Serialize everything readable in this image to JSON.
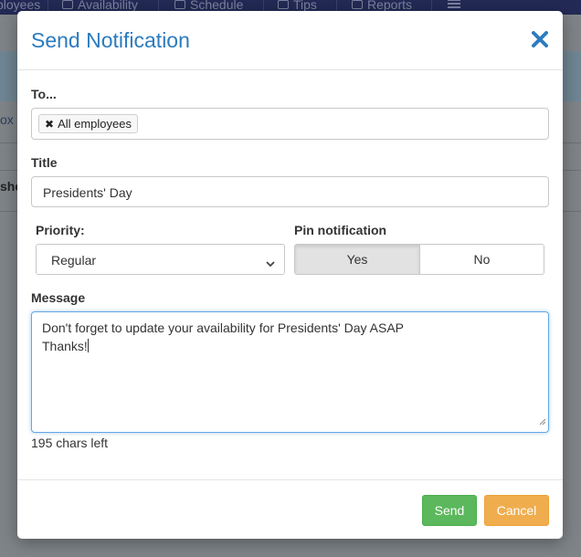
{
  "background_app": {
    "nav_items": [
      {
        "label": "ployees",
        "icon": ""
      },
      {
        "label": "Availability",
        "icon": "calendar-check-icon"
      },
      {
        "label": "Schedule",
        "icon": "grid-icon"
      },
      {
        "label": "Tips",
        "icon": "money-icon"
      },
      {
        "label": "Reports",
        "icon": "chart-icon"
      },
      {
        "label": "",
        "icon": "menu-icon"
      }
    ],
    "side_text_1": "ox",
    "side_text_2": "she"
  },
  "modal": {
    "title": "Send Notification",
    "close_icon": "close-icon",
    "to": {
      "label": "To...",
      "tags": [
        {
          "label": "All employees",
          "remove_icon": "close-icon"
        }
      ]
    },
    "title_field": {
      "label": "Title",
      "value": "Presidents' Day"
    },
    "priority": {
      "label": "Priority:",
      "selected": "Regular"
    },
    "pin": {
      "label": "Pin notification",
      "options": [
        "Yes",
        "No"
      ],
      "selected": "Yes"
    },
    "message": {
      "label": "Message",
      "lines": [
        "Don't forget to update your availability for Presidents' Day ASAP",
        "Thanks!"
      ]
    },
    "chars_left": "195 chars left",
    "buttons": {
      "send": "Send",
      "cancel": "Cancel"
    }
  },
  "colors": {
    "title": "#2c7bbf",
    "send": "#5cb85c",
    "cancel": "#f0ad4e",
    "nav": "#232a55"
  }
}
